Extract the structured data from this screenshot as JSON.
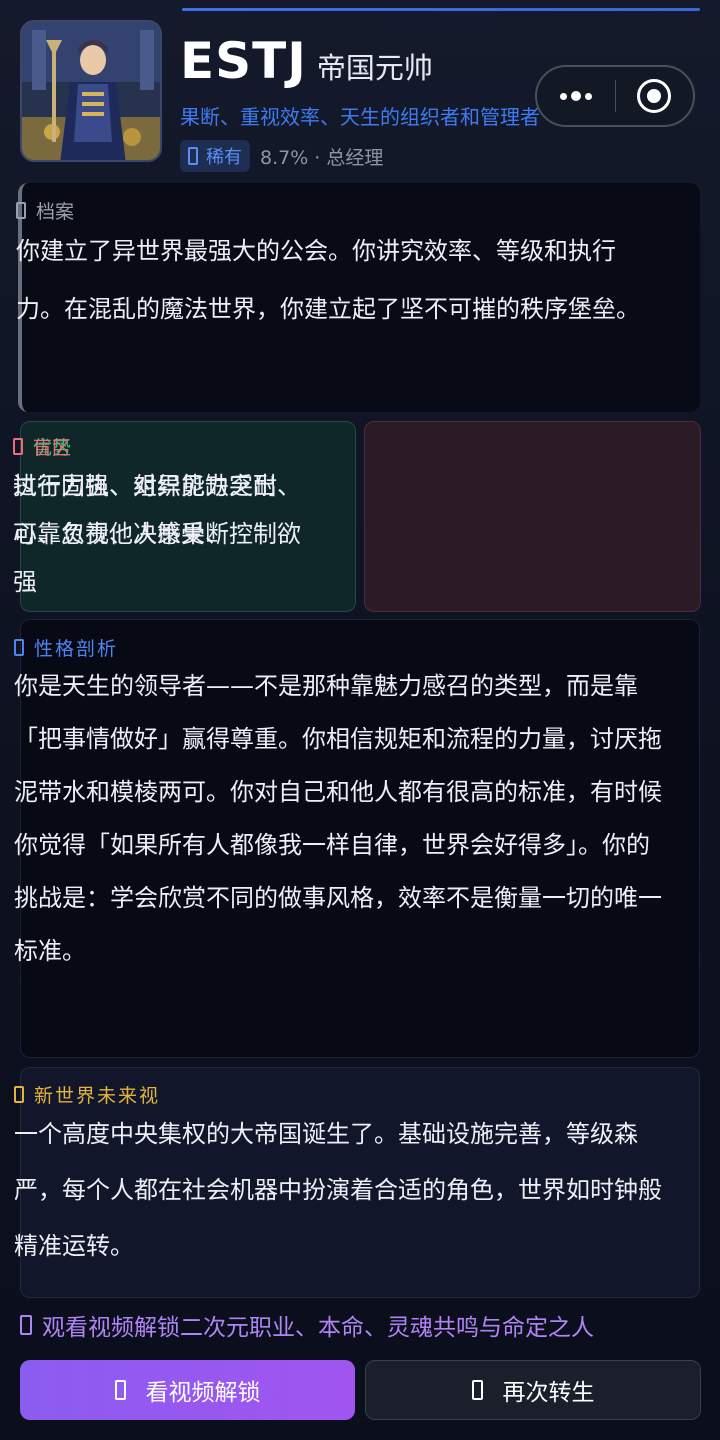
{
  "header": {
    "type_code": "ESTJ",
    "type_name": "帝国元帅",
    "subtitle": "果断、重视效率、天生的组织者和管理者",
    "rarity_label": "稀有",
    "rarity_meta": "8.7% · 总经理",
    "avatar_icon": "general-portrait"
  },
  "mini_program_capsule": {
    "more_icon": "more-dots-icon",
    "close_icon": "target-close-icon"
  },
  "archive": {
    "title": "档案",
    "body": "你建立了异世界最强大的公会。你讲究效率、等级和执行力。在混乱的魔法世界，你建立起了坚不可摧的秩序堡垒。"
  },
  "strengths": {
    "title": "优势",
    "body": "执行力强、组织能力突出、可靠负责、决策果断"
  },
  "blindspots": {
    "title": "盲区",
    "body": "过于固执、对异见缺乏耐心、忽视他人感受、控制欲强"
  },
  "analysis": {
    "title": "性格剖析",
    "body": "你是天生的领导者——不是那种靠魅力感召的类型，而是靠「把事情做好」赢得尊重。你相信规矩和流程的力量，讨厌拖泥带水和模棱两可。你对自己和他人都有很高的标准，有时候你觉得「如果所有人都像我一样自律，世界会好得多」。你的挑战是：学会欣赏不同的做事风格，效率不是衡量一切的唯一标准。"
  },
  "future": {
    "title": "新世界未来视",
    "body": "一个高度中央集权的大帝国诞生了。基础设施完善，等级森严，每个人都在社会机器中扮演着合适的角色，世界如时钟般精准运转。"
  },
  "unlock_tip": "观看视频解锁二次元职业、本命、灵魂共鸣与命定之人",
  "buttons": {
    "watch_video": "看视频解锁",
    "reincarnate": "再次转生"
  },
  "colors": {
    "accent_blue": "#3e7bf0",
    "strength_green": "#34c77a",
    "blindspot_red": "#f06a7a",
    "future_gold": "#e4b33a",
    "primary_purple": "#9a58f0"
  }
}
